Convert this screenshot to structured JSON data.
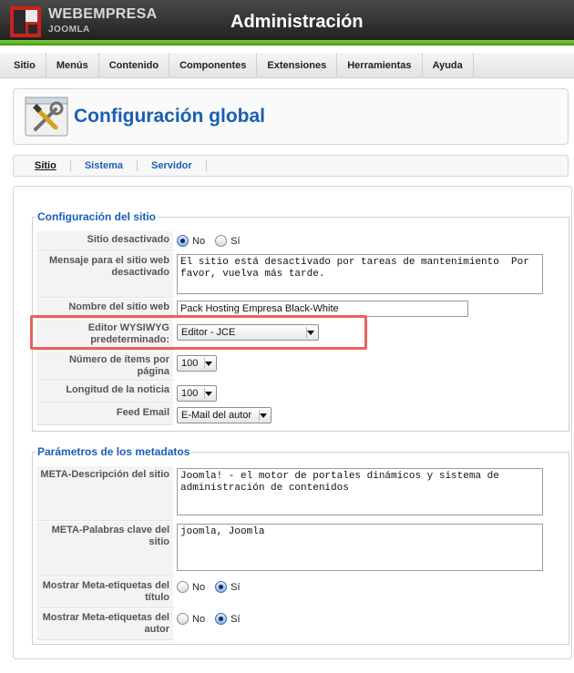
{
  "header": {
    "brand_name": "WEBEMPRESA",
    "brand_sub": "JOOMLA",
    "title": "Administración"
  },
  "menu": [
    "Sitio",
    "Menús",
    "Contenido",
    "Componentes",
    "Extensiones",
    "Herramientas",
    "Ayuda"
  ],
  "page_title": "Configuración global",
  "tabs": [
    "Sitio",
    "Sistema",
    "Servidor"
  ],
  "site_config": {
    "legend": "Configuración del sitio",
    "offline_label": "Sitio desactivado",
    "offline_no": "No",
    "offline_yes": "Sí",
    "offline_value": "No",
    "offline_msg_label": "Mensaje para el sitio web desactivado",
    "offline_msg_value": "El sitio está desactivado por tareas de mantenimiento  Por favor, vuelva más tarde.",
    "site_name_label": "Nombre del sitio web",
    "site_name_value": "Pack Hosting Empresa Black-White",
    "editor_label": "Editor WYSIWYG predeterminado:",
    "editor_value": "Editor - JCE",
    "list_limit_label": "Número de ítems por página",
    "list_limit_value": "100",
    "feed_limit_label": "Longitud de la noticia",
    "feed_limit_value": "100",
    "feed_email_label": "Feed Email",
    "feed_email_value": "E-Mail del autor"
  },
  "metadata": {
    "legend": "Parámetros de los metadatos",
    "meta_desc_label": "META-Descripción del sitio",
    "meta_desc_value": "Joomla! - el motor de portales dinámicos y sistema de administración de contenidos",
    "meta_keys_label": "META-Palabras clave del sitio",
    "meta_keys_value": "joomla, Joomla",
    "meta_title_label": "Mostrar Meta-etiquetas del título",
    "meta_title_value": "Sí",
    "meta_author_label": "Mostrar Meta-etiquetas del autor",
    "meta_author_value": "Sí",
    "no": "No",
    "yes": "Sí"
  },
  "colors": {
    "accent_blue": "#1a5fb4",
    "green_bar": "#5cb82a",
    "highlight_red": "#e8645a"
  }
}
